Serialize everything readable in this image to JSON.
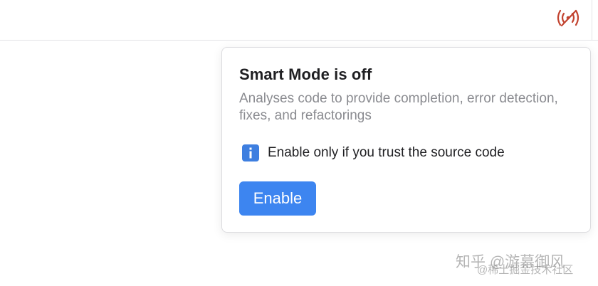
{
  "toolbar": {
    "smart_mode_icon": "smart-mode-off-broadcast-icon",
    "icon_color": "#c2432f"
  },
  "popup": {
    "title": "Smart Mode is off",
    "description": "Analyses code to provide completion, error detection, fixes, and refactorings",
    "hint_icon": "info-icon",
    "hint_text": "Enable only if you trust the source code",
    "enable_label": "Enable",
    "accent_color": "#3d85f0"
  },
  "watermark": {
    "primary": "知乎 @游幕御风",
    "secondary": "@稀土掘金技术社区"
  }
}
